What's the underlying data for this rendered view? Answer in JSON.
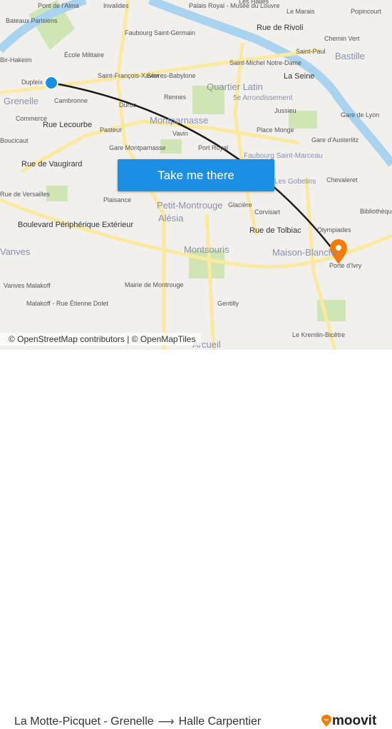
{
  "map": {
    "labels": [
      "Pont de l'Alma",
      "Invalides",
      "Palais Royal - Musée du Louvre",
      "Les Halles",
      "Le Marais",
      "Popincourt",
      "Bateaux Parisiens",
      "Faubourg Saint-Germain",
      "Rue de Rivoli",
      "Chemin Vert",
      "Bir-Hakeim",
      "École Militaire",
      "Saint-Paul",
      "Bastille",
      "Dupleix",
      "Saint-François-Xavier",
      "Sèvres-Babylone",
      "Saint-Michel Notre-Dame",
      "Quartier Latin",
      "Grenelle",
      "Cambronne",
      "Rennes",
      "5e Arrondissement",
      "Jussieu",
      "Gare de Lyon",
      "Commerce",
      "Rue Lecourbe",
      "Duroc",
      "Montparnasse",
      "Pasteur",
      "Vavin",
      "Place Monge",
      "Gare d'Austerlitz",
      "Rue de Vaugirard",
      "Gare Montparnasse",
      "Port Royal",
      "Faubourg Saint-Marceau",
      "Les Gobelins",
      "Chevaleret",
      "Plaisance",
      "Petit-Montrouge",
      "Glacière",
      "Corvisart",
      "Alésia",
      "Boulevard Périphérique Extérieur",
      "Rue de Tolbiac",
      "Olympiades",
      "Bibliothèque François Mitterrand",
      "Vanves",
      "Montsouris",
      "Maison-Blanche",
      "Porte d'Ivry",
      "Vanves Malakoff",
      "Mairie de Montrouge",
      "Malakoff - Rue Étienne Dolet",
      "Gentilly",
      "Arcueil",
      "Le Kremlin-Bicêtre",
      "La Seine",
      "Rue de Versailles",
      "Boucicaut"
    ],
    "cta": "Take me there",
    "attribution": "© OpenStreetMap contributors | © OpenMapTiles",
    "colors": {
      "water": "#aad3f0",
      "park": "#cfe5b5",
      "road": "#fbe9a0",
      "route": "#1a1a1a",
      "origin": "#1a8fe3",
      "destination": "#f57c00",
      "button": "#1a8fe3"
    }
  },
  "footer": {
    "origin": "La Motte-Picquet - Grenelle",
    "arrow": "⟶",
    "destination": "Halle Carpentier",
    "brand": "moovit"
  }
}
